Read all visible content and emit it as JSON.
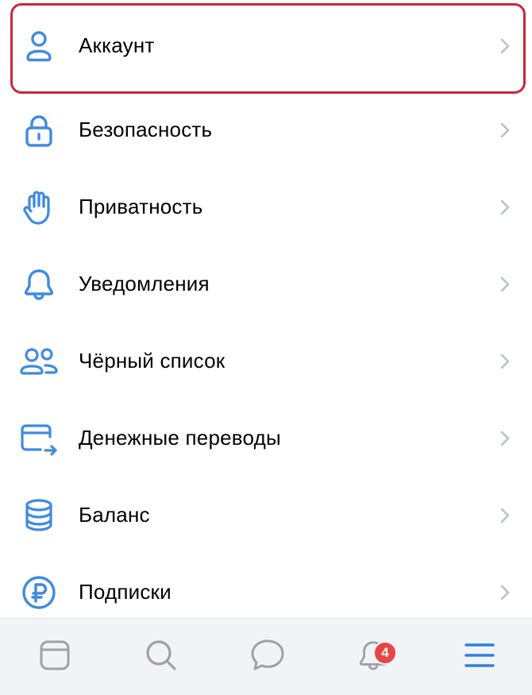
{
  "colors": {
    "accent": "#3f8ae0",
    "highlight_border": "#c8283c",
    "chevron": "#b8c1cc",
    "tab_icon": "#99a2ad",
    "tab_active": "#2d81e0",
    "badge": "#e64646"
  },
  "menu": {
    "items": [
      {
        "label": "Аккаунт",
        "icon": "person-icon"
      },
      {
        "label": "Безопасность",
        "icon": "lock-icon"
      },
      {
        "label": "Приватность",
        "icon": "hand-icon"
      },
      {
        "label": "Уведомления",
        "icon": "bell-icon"
      },
      {
        "label": "Чёрный список",
        "icon": "users-icon"
      },
      {
        "label": "Денежные переводы",
        "icon": "card-transfer-icon"
      },
      {
        "label": "Баланс",
        "icon": "coins-stack-icon"
      },
      {
        "label": "Подписки",
        "icon": "ruble-icon"
      }
    ]
  },
  "tabbar": {
    "items": [
      {
        "name": "feed",
        "icon": "newsfeed-icon"
      },
      {
        "name": "search",
        "icon": "search-icon"
      },
      {
        "name": "messages",
        "icon": "message-icon"
      },
      {
        "name": "notifications",
        "icon": "bell-icon",
        "badge": "4"
      },
      {
        "name": "menu",
        "icon": "hamburger-menu-icon",
        "active": true
      }
    ]
  }
}
